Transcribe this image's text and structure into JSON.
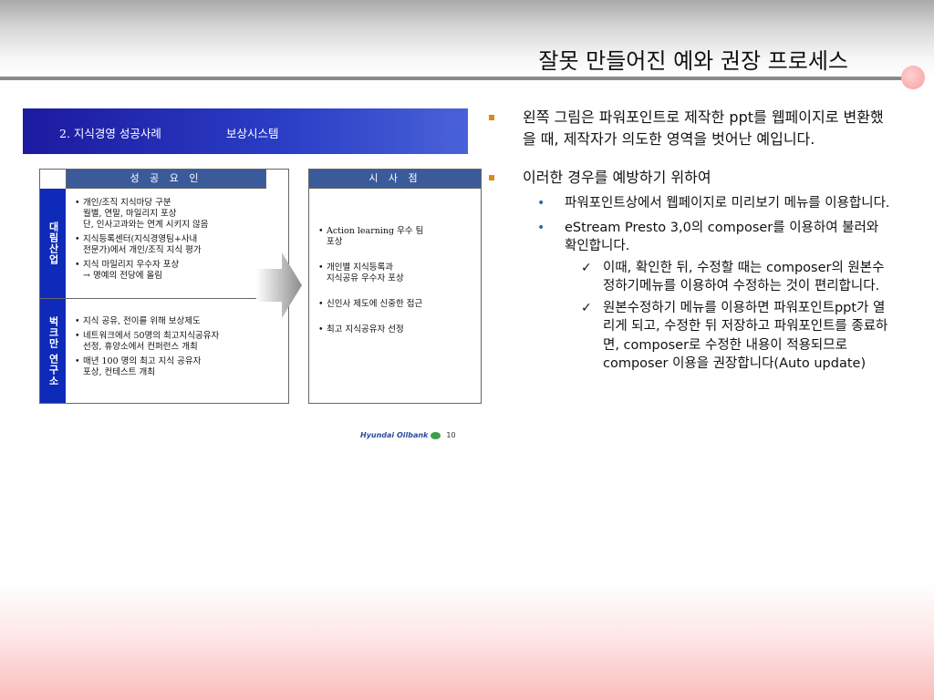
{
  "slide": {
    "title": "잘못 만들어진 예와 권장 프로세스"
  },
  "embedded": {
    "header_left": "2. 지식경영 성공사례",
    "header_right": "보상시스템",
    "left_head": "성 공 요 인",
    "right_head": "시 사 점",
    "section1_label": "대림산업",
    "section2_label": "벅크만 연구소",
    "section1_items": [
      "개인/조직 지식마당 구분\n월별, 연말, 마일리지 포상\n단, 인사고과와는 연계 시키지 않음",
      "지식등록센터(지식경영팀+사내\n전문가)에서 개인/조직 지식 평가",
      "지식 마일리지 우수자 포상\n→ 명예의 전당에 올림"
    ],
    "section2_items": [
      "지식 공유, 전이를 위해 보상제도",
      "네트워크에서 50명의 최고지식공유자\n선정, 휴양소에서 컨퍼런스 개최",
      "매년 100 명의 최고 지식 공유자\n포상, 컨테스트 개최"
    ],
    "right_items": [
      "Action learning 우수 팀\n포상",
      "개인별 지식등록과\n지식공유 우수자 포상",
      "신인사 제도에 신중한 접근",
      "최고 지식공유자 선정"
    ],
    "logo_text": "Hyundai Oilbank",
    "page_number": "10"
  },
  "bullets": {
    "b1": "왼쪽 그림은 파워포인트로 제작한 ppt를 웹페이지로 변환했을 때, 제작자가 의도한 영역을 벗어난 예입니다.",
    "b2": "이러한 경우를 예방하기 위하여",
    "b2_subs": [
      "파워포인트상에서 웹페이지로 미리보기 메뉴를 이용합니다.",
      "eStream Presto 3,0의 composer를 이용하여 불러와 확인합니다."
    ],
    "checks": [
      "이때, 확인한 뒤, 수정할 때는 composer의 원본수정하기메뉴를 이용하여 수정하는 것이 편리합니다.",
      "원본수정하기 메뉴를 이용하면 파워포인트ppt가 열리게 되고, 수정한 뒤 저장하고 파워포인트를 종료하면, composer로 수정한 내용이 적용되므로 composer 이용을 권장합니다(Auto update)"
    ]
  },
  "colors": {
    "accent_bullet": "#d98a1b",
    "sub_bullet": "#2a6aa8",
    "header_blue": "#1c1aa0",
    "section_blue": "#0e2ab8"
  }
}
